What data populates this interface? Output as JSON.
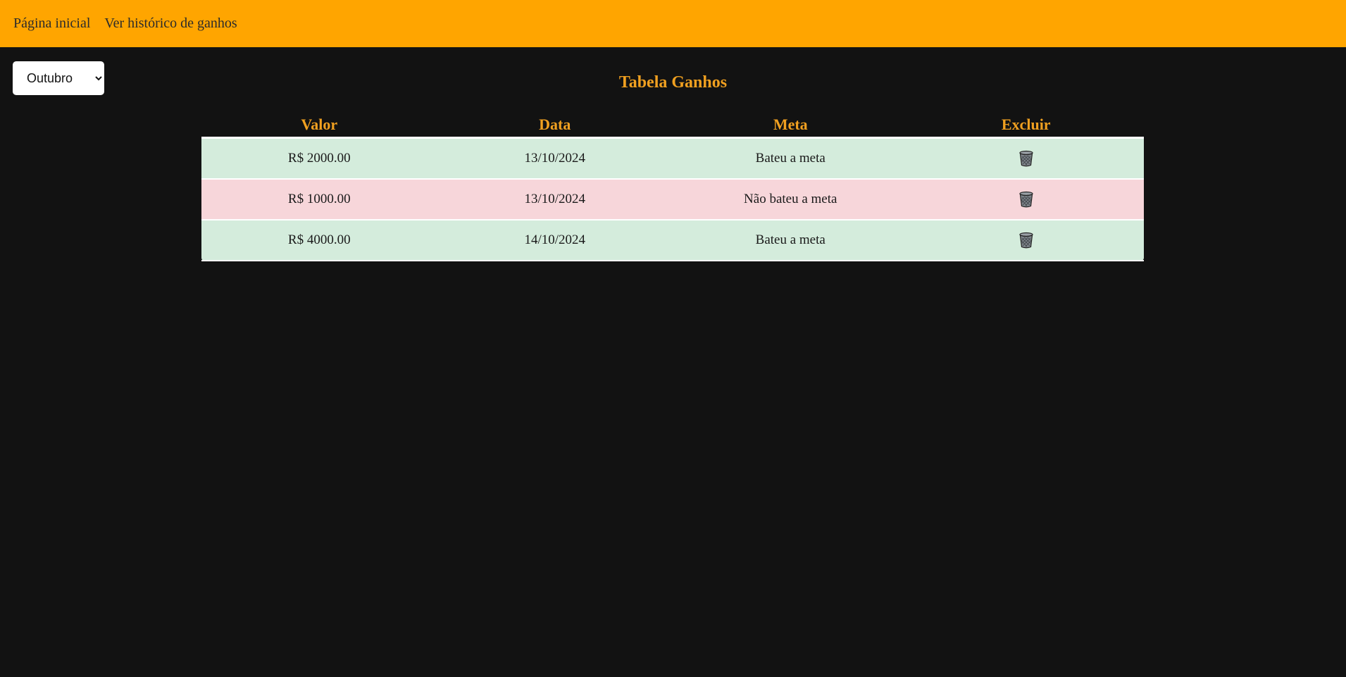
{
  "nav": {
    "home": "Página inicial",
    "history": "Ver histórico de ganhos"
  },
  "filter": {
    "month": "Outubro"
  },
  "table": {
    "title": "Tabela Ganhos",
    "headers": {
      "valor": "Valor",
      "data": "Data",
      "meta": "Meta",
      "excluir": "Excluir"
    },
    "rows": [
      {
        "valor": "R$ 2000.00",
        "data": "13/10/2024",
        "meta": "Bateu a meta"
      },
      {
        "valor": "R$ 1000.00",
        "data": "13/10/2024",
        "meta": "Não bateu a meta"
      },
      {
        "valor": "R$ 4000.00",
        "data": "14/10/2024",
        "meta": "Bateu a meta"
      }
    ],
    "delete_icon": "trash-icon"
  },
  "colors": {
    "navbar": "#ffa500",
    "background": "#121212",
    "accent_text": "#f0a020",
    "row_met": "#d4ecdc",
    "row_not_met": "#f7d6da"
  }
}
